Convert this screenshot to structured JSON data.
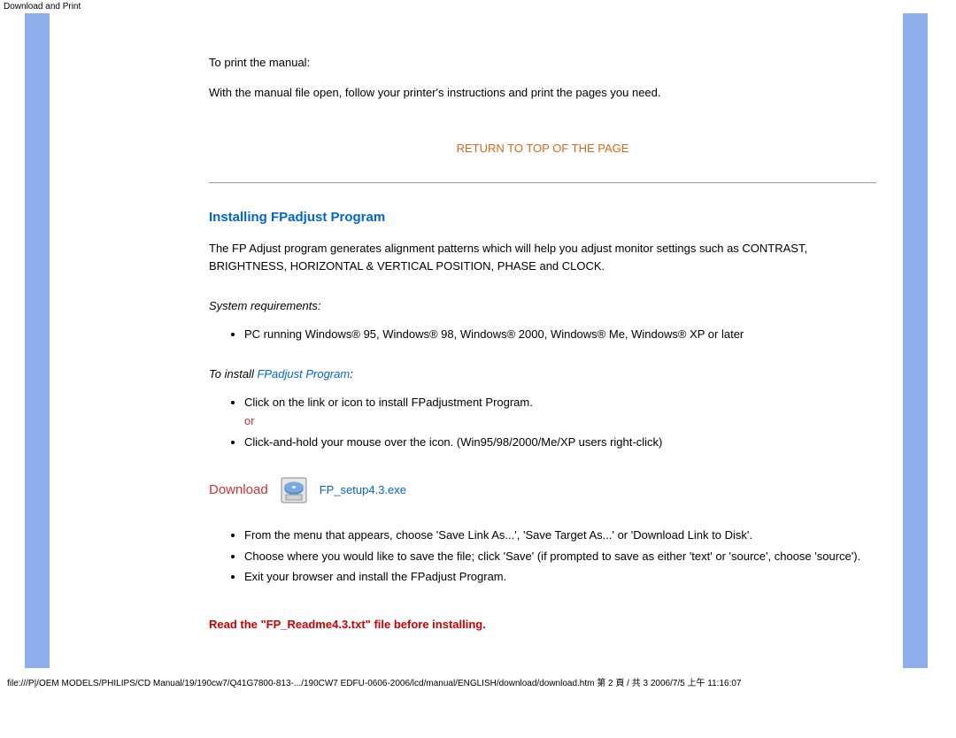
{
  "page_header": "Download and Print",
  "intro": {
    "print_label": "To print the manual:",
    "print_instr": "With the manual file open, follow your printer's instructions and print the pages you need."
  },
  "return_top": "RETURN TO TOP OF THE PAGE",
  "install": {
    "heading": "Installing FPadjust Program",
    "desc": "The FP Adjust program generates alignment patterns which will help you adjust monitor settings such as CONTRAST, BRIGHTNESS, HORIZONTAL & VERTICAL POSITION, PHASE and CLOCK.",
    "sysreq_label": "System requirements:",
    "sysreq_items": [
      "PC running Windows® 95, Windows® 98, Windows® 2000, Windows® Me, Windows® XP or later"
    ],
    "toinstall_prefix": "To install ",
    "toinstall_link": "FPadjust Program",
    "toinstall_suffix": ":",
    "install_steps_1": "Click on the link or icon to install FPadjustment Program.",
    "or_word": "or",
    "install_steps_2": "Click-and-hold your mouse over the icon. (Win95/98/2000/Me/XP users right-click)",
    "download_label": "Download",
    "download_filename": "FP_setup4.3.exe",
    "after_steps": [
      "From the menu that appears, choose 'Save Link As...', 'Save Target As...' or 'Download Link to Disk'.",
      "Choose where you would like to save the file; click 'Save' (if prompted to save as either 'text' or 'source', choose 'source').",
      "Exit your browser and install the FPadjust Program."
    ],
    "warn": "Read the \"FP_Readme4.3.txt\" file before installing."
  },
  "footer": "file:///P|/OEM MODELS/PHILIPS/CD Manual/19/190cw7/Q41G7800-813-.../190CW7 EDFU-0606-2006/lcd/manual/ENGLISH/download/download.htm 第 2 頁 / 共 3 2006/7/5 上午 11:16:07"
}
